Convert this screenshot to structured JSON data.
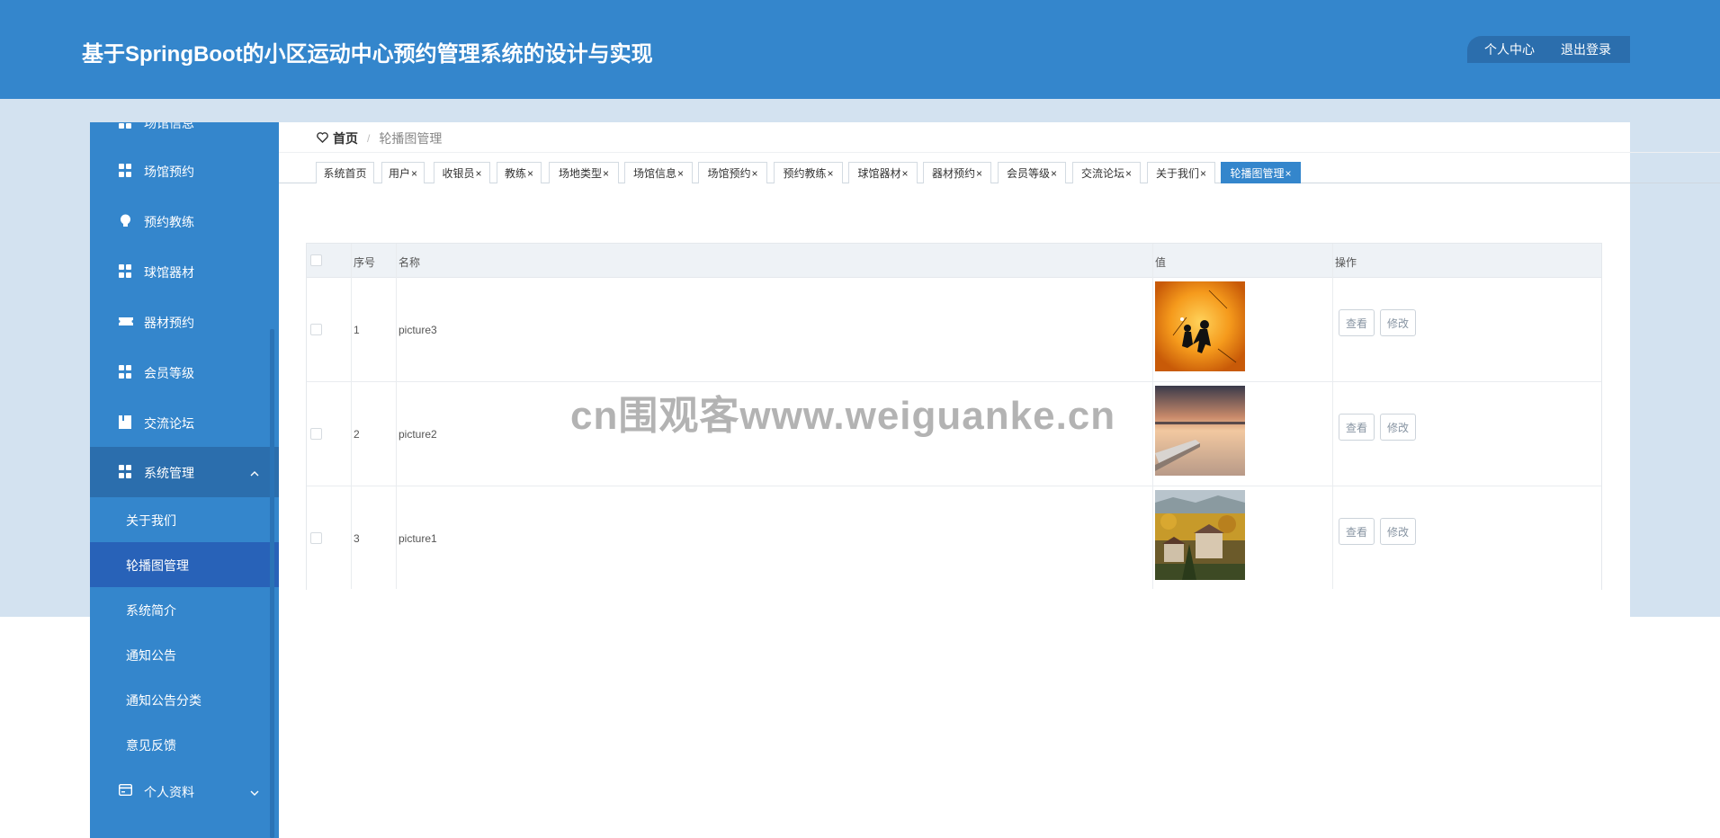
{
  "header": {
    "title": "基于SpringBoot的小区运动中心预约管理系统的设计与实现",
    "profile_label": "个人中心",
    "logout_label": "退出登录"
  },
  "sidebar": {
    "partial_item_label": "场馆信息",
    "items": [
      {
        "label": "场馆预约",
        "icon": "grid-icon"
      },
      {
        "label": "预约教练",
        "icon": "bulb-icon"
      },
      {
        "label": "球馆器材",
        "icon": "grid-icon"
      },
      {
        "label": "器材预约",
        "icon": "ticket-icon"
      },
      {
        "label": "会员等级",
        "icon": "grid-icon"
      },
      {
        "label": "交流论坛",
        "icon": "book-icon"
      }
    ],
    "system_group": {
      "label": "系统管理",
      "icon": "grid-icon",
      "expanded": true,
      "children": [
        {
          "label": "关于我们"
        },
        {
          "label": "轮播图管理",
          "active": true
        },
        {
          "label": "系统简介"
        },
        {
          "label": "通知公告"
        },
        {
          "label": "通知公告分类"
        },
        {
          "label": "意见反馈"
        }
      ]
    },
    "profile_group": {
      "label": "个人资料",
      "icon": "card-icon",
      "expanded": false
    }
  },
  "breadcrumb": {
    "home": "首页",
    "separator": "/",
    "current": "轮播图管理"
  },
  "tabs": [
    {
      "label": "系统首页",
      "closable": false
    },
    {
      "label": "用户",
      "closable": true
    },
    {
      "label": "收银员",
      "closable": true
    },
    {
      "label": "教练",
      "closable": true
    },
    {
      "label": "场地类型",
      "closable": true
    },
    {
      "label": "场馆信息",
      "closable": true
    },
    {
      "label": "场馆预约",
      "closable": true
    },
    {
      "label": "预约教练",
      "closable": true
    },
    {
      "label": "球馆器材",
      "closable": true
    },
    {
      "label": "器材预约",
      "closable": true
    },
    {
      "label": "会员等级",
      "closable": true
    },
    {
      "label": "交流论坛",
      "closable": true
    },
    {
      "label": "关于我们",
      "closable": true
    },
    {
      "label": "轮播图管理",
      "closable": true,
      "active": true
    }
  ],
  "table": {
    "columns": [
      "序号",
      "名称",
      "值",
      "操作"
    ],
    "rows": [
      {
        "index": "1",
        "name": "picture3",
        "image": "orange-silhouette-image"
      },
      {
        "index": "2",
        "name": "picture2",
        "image": "sunset-lake-pier-image"
      },
      {
        "index": "3",
        "name": "picture1",
        "image": "autumn-village-image"
      }
    ],
    "view_label": "查看",
    "edit_label": "修改"
  },
  "watermark": "cn围观客www.weiguanke.cn",
  "colors": {
    "primary": "#3486cc",
    "primary_dark": "#2b6ead",
    "active_sub": "#2862b8",
    "band": "#d3e2f0"
  }
}
